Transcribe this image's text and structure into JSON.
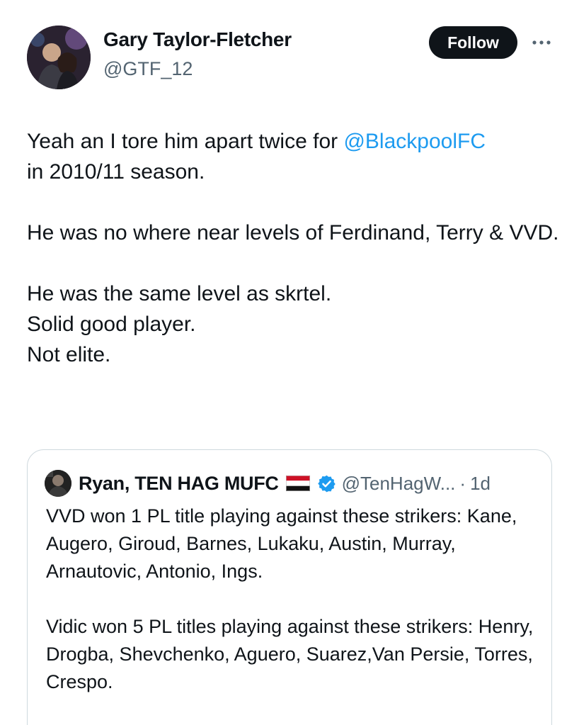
{
  "author": {
    "name": "Gary Taylor-Fletcher",
    "handle": "@GTF_12",
    "follow_label": "Follow",
    "more_icon": "more-horizontal-icon"
  },
  "tweet": {
    "line1_before": "Yeah an I tore him apart twice for ",
    "mention": "@BlackpoolFC",
    "line1_after": "in 2010/11 season.",
    "paragraph2": "He was no where near levels of Ferdinand, Terry & VVD.",
    "paragraph3_lines": [
      "He was the same level as skrtel.",
      "Solid good player.",
      "Not elite."
    ]
  },
  "quote": {
    "name": "Ryan, TEN HAG MUFC",
    "flag_icon": "yemen-flag-icon",
    "verified_icon": "verified-badge-icon",
    "handle": "@TenHagW...",
    "separator": "·",
    "time": "1d",
    "paragraph1": "VVD won 1 PL title playing against these strikers: Kane, Augero, Giroud, Barnes, Lukaku, Austin, Murray, Arnautovic, Antonio, Ings.",
    "paragraph2": "Vidic won 5 PL titles playing against these strikers: Henry, Drogba, Shevchenko, Aguero, Suarez,Van Persie, Torres, Crespo."
  },
  "colors": {
    "link": "#1d9bf0",
    "text": "#0f1419",
    "secondary": "#536471",
    "border": "#cfd9de",
    "verified": "#1d9bf0"
  }
}
